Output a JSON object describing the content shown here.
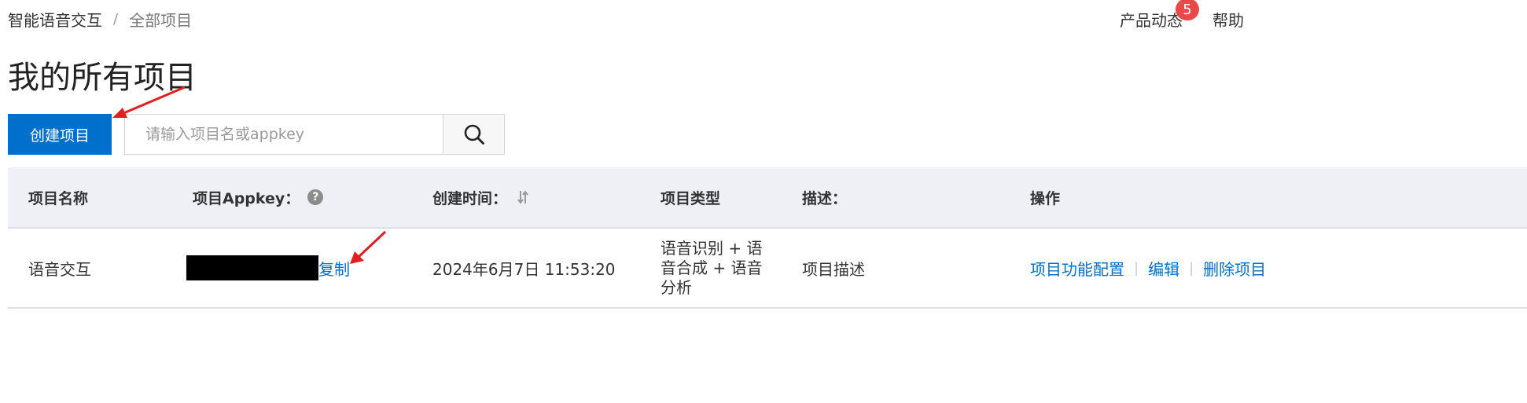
{
  "breadcrumb": {
    "root": "智能语音交互",
    "separator": "/",
    "current": "全部项目"
  },
  "topbar": {
    "product_news": "产品动态",
    "news_badge": "5",
    "help": "帮助"
  },
  "page_title": "我的所有项目",
  "toolbar": {
    "create_label": "创建项目",
    "search_placeholder": "请输入项目名或appkey",
    "search_icon": "search-icon"
  },
  "table": {
    "headers": {
      "name": "项目名称",
      "appkey": "项目Appkey：",
      "created": "创建时间：",
      "type": "项目类型",
      "desc": "描述：",
      "ops": "操作"
    },
    "rows": [
      {
        "name": "语音交互",
        "appkey_copy": "复制",
        "created": "2024年6月7日 11:53:20",
        "type": "语音识别 + 语音合成 + 语音分析",
        "desc": "项目描述",
        "op_config": "项目功能配置",
        "op_edit": "编辑",
        "op_delete": "删除项目"
      }
    ]
  },
  "colors": {
    "primary": "#0070cc",
    "badge": "#e84a4a",
    "header_bg": "#eef0f5",
    "annotation_arrow": "#e02020"
  }
}
